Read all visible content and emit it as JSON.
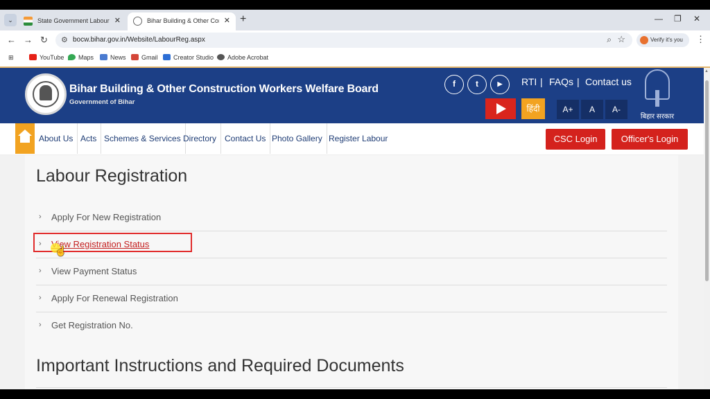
{
  "browser": {
    "tabs": [
      {
        "title": "State Government Labour Depa"
      },
      {
        "title": "Bihar Building & Other Constru"
      }
    ],
    "url": "bocw.bihar.gov.in/Website/LabourReg.aspx",
    "profile_label": "Verify it's you",
    "bookmarks": [
      "YouTube",
      "Maps",
      "News",
      "Gmail",
      "Creator Studio",
      "Adobe Acrobat"
    ]
  },
  "header": {
    "title": "Bihar Building & Other Construction Workers Welfare Board",
    "subtitle": "Government of Bihar",
    "links": [
      "RTI",
      "FAQs",
      "Contact us"
    ],
    "hindi_label": "हिंदी",
    "font_sizes": [
      "A+",
      "A",
      "A-"
    ],
    "emblem_text": "बिहार सरकार"
  },
  "nav": {
    "items": [
      "About Us",
      "Acts",
      "Schemes & Services",
      "Directory",
      "Contact Us",
      "Photo Gallery",
      "Register Labour"
    ],
    "csc_login": "CSC Login",
    "officer_login": "Officer's Login"
  },
  "main": {
    "title": "Labour Registration",
    "options": [
      "Apply For New Registration",
      "View Registration Status",
      "View Payment Status",
      "Apply For Renewal Registration",
      "Get Registration No."
    ],
    "section_title": "Important Instructions and Required Documents"
  },
  "colors": {
    "header_blue": "#1c3f86",
    "accent_orange": "#f2a321",
    "button_red": "#d4221d",
    "highlight_red": "#e12b2b"
  }
}
